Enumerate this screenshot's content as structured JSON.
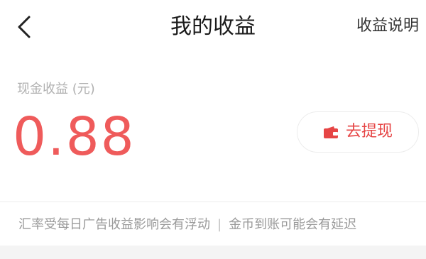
{
  "header": {
    "title": "我的收益",
    "help_link": "收益说明"
  },
  "earnings": {
    "label": "现金收益 (元)",
    "amount": "0.88",
    "withdraw_label": "去提现"
  },
  "notice": {
    "part1": "汇率受每日广告收益影响会有浮动",
    "separator": "|",
    "part2": "金币到账可能会有延迟"
  },
  "icons": {
    "back": "chevron-left-icon",
    "wallet": "wallet-icon"
  },
  "colors": {
    "accent": "#ef5b5b",
    "withdraw_text": "#e64545"
  }
}
